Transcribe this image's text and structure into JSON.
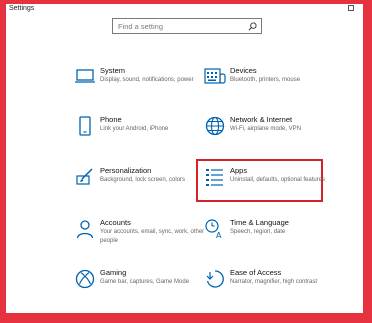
{
  "window": {
    "title": "Settings"
  },
  "search": {
    "placeholder": "Find a setting"
  },
  "colors": {
    "accent": "#0063b1",
    "highlight": "#d3232c",
    "frame": "#e5323e"
  },
  "tiles": [
    {
      "title": "System",
      "desc": "Display, sound, notifications, power",
      "icon": "laptop-icon"
    },
    {
      "title": "Devices",
      "desc": "Bluetooth, printers, mouse",
      "icon": "keyboard-icon"
    },
    {
      "title": "Phone",
      "desc": "Link your Android, iPhone",
      "icon": "phone-icon"
    },
    {
      "title": "Network & Internet",
      "desc": "Wi-Fi, airplane mode, VPN",
      "icon": "globe-icon"
    },
    {
      "title": "Personalization",
      "desc": "Background, lock screen, colors",
      "icon": "brush-icon"
    },
    {
      "title": "Apps",
      "desc": "Uninstall, defaults, optional features",
      "icon": "apps-list-icon"
    },
    {
      "title": "Accounts",
      "desc": "Your accounts, email, sync, work, other people",
      "icon": "person-icon"
    },
    {
      "title": "Time & Language",
      "desc": "Speech, region, date",
      "icon": "clock-language-icon"
    },
    {
      "title": "Gaming",
      "desc": "Game bar, captures, Game Mode",
      "icon": "xbox-icon"
    },
    {
      "title": "Ease of Access",
      "desc": "Narrator, magnifier, high contrast",
      "icon": "ease-of-access-icon"
    }
  ]
}
